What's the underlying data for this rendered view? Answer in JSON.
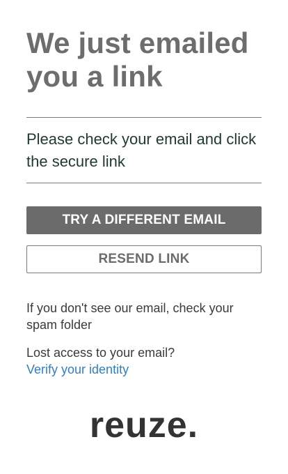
{
  "header": {
    "title": "We just emailed you a link"
  },
  "message": {
    "text": "Please check your email and click the secure link"
  },
  "actions": {
    "try_different_email_label": "TRY A DIFFERENT EMAIL",
    "resend_link_label": "RESEND LINK"
  },
  "help": {
    "spam_text": "If you don't see our email, check your spam folder",
    "lost_access_text": "Lost access to your email?",
    "verify_link_text": "Verify your identity"
  },
  "brand": {
    "logo_text": "reuze."
  },
  "colors": {
    "title": "#6d6d6d",
    "subtitle": "#1f3a2d",
    "primary_button": "#6b6b6b",
    "link": "#2f7fc6",
    "logo": "#333333"
  }
}
